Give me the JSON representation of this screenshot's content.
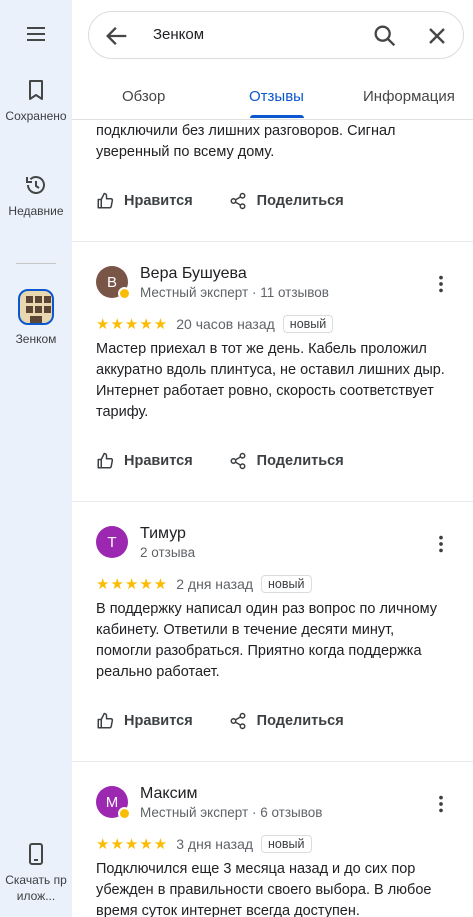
{
  "rail": {
    "menu_icon": "menu-icon",
    "saved_label": "Сохранено",
    "recent_label": "Недавние",
    "place_label": "Зенком",
    "download_label": "Скачать прилож..."
  },
  "search": {
    "query": "Зенком",
    "icons": [
      "arrow-back-icon",
      "search-icon",
      "close-icon"
    ]
  },
  "tabs": [
    {
      "label": "Обзор",
      "active": false
    },
    {
      "label": "Отзывы",
      "active": true
    },
    {
      "label": "Информация",
      "active": false
    }
  ],
  "colors": {
    "accent": "#0b57d0",
    "star": "#fbbc04",
    "rail_bg": "#eaf1fb"
  },
  "partial_review": {
    "text": "подключили без лишних разговоров. Сигнал уверенный по всему дому.",
    "like_label": "Нравится",
    "share_label": "Поделиться"
  },
  "reviews": [
    {
      "initial": "В",
      "avatar_color": "#795548",
      "name": "Вера Бушуева",
      "meta": "Местный эксперт · 11 отзывов",
      "rating": 5,
      "stars": "★★★★★",
      "when": "20 часов назад",
      "badge": "новый",
      "text": "Мастер приехал в тот же день. Кабель проложил аккуратно вдоль плинтуса, не оставил лишних дыр. Интернет работает ровно, скорость соответствует тарифу.",
      "like_label": "Нравится",
      "share_label": "Поделиться"
    },
    {
      "initial": "Т",
      "avatar_color": "#9c27b0",
      "name": "Тимур",
      "meta": "2 отзыва",
      "rating": 5,
      "stars": "★★★★★",
      "when": "2 дня назад",
      "badge": "новый",
      "text": "В поддержку написал один раз  вопрос по личному кабинету. Ответили в течение десяти минут, помогли разобраться. Приятно когда поддержка реально работает.",
      "like_label": "Нравится",
      "share_label": "Поделиться"
    },
    {
      "initial": "М",
      "avatar_color": "#9c27b0",
      "name": "Максим",
      "meta": "Местный эксперт · 6 отзывов",
      "rating": 5,
      "stars": "★★★★★",
      "when": "3 дня назад",
      "badge": "новый",
      "text": "Подключился еще 3 месяца назад и до сих пор убежден в правильности своего выбора. В любое время суток интернет всегда доступен."
    }
  ]
}
